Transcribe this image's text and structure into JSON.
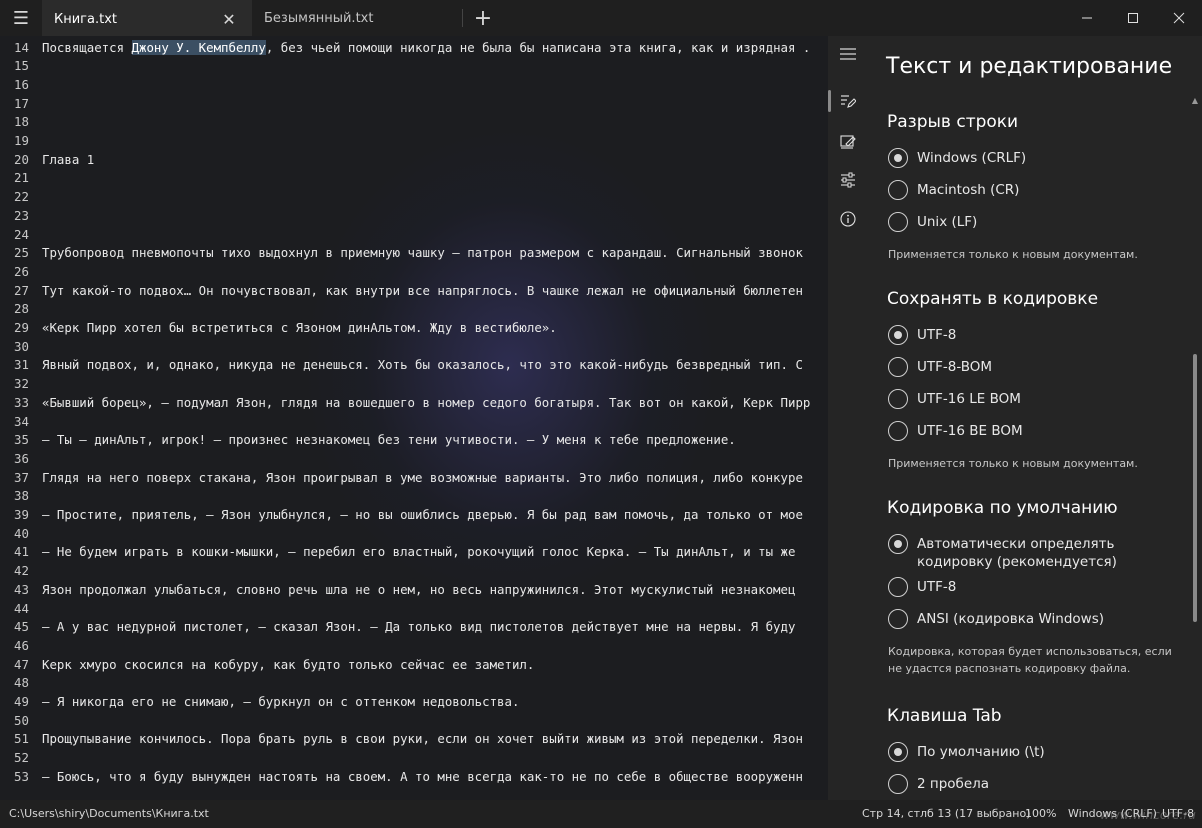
{
  "tabs": [
    {
      "label": "Книга.txt",
      "active": true
    },
    {
      "label": "Безымянный.txt",
      "active": false
    }
  ],
  "icons": {
    "menu": "hamburger-icon",
    "close": "close-icon",
    "add": "plus-icon",
    "minimize": "minimize-icon",
    "maximize": "maximize-icon"
  },
  "editor": {
    "highlight_color": "#3b4f63",
    "lines": [
      {
        "n": "14",
        "pre": "Посвящается ",
        "hl": "Джону У. Кемпбеллу",
        "post": ", без чьей помощи никогда не была бы написана эта книга, как и изрядная ."
      },
      {
        "n": "15",
        "text": ""
      },
      {
        "n": "16",
        "text": ""
      },
      {
        "n": "17",
        "text": ""
      },
      {
        "n": "18",
        "text": ""
      },
      {
        "n": "19",
        "text": ""
      },
      {
        "n": "20",
        "text": "Глава 1"
      },
      {
        "n": "21",
        "text": ""
      },
      {
        "n": "22",
        "text": ""
      },
      {
        "n": "23",
        "text": ""
      },
      {
        "n": "24",
        "text": ""
      },
      {
        "n": "25",
        "text": "Трубопровод пневмопочты тихо выдохнул в приемную чашку – патрон размером с карандаш. Сигнальный звонок"
      },
      {
        "n": "26",
        "text": ""
      },
      {
        "n": "27",
        "text": "Тут какой-то подвох… Он почувствовал, как внутри все напряглось. В чашке лежал не официальный бюллетен"
      },
      {
        "n": "28",
        "text": ""
      },
      {
        "n": "29",
        "text": "«Керк Пирр хотел бы встретиться с Язоном динАльтом. Жду в вестибюле»."
      },
      {
        "n": "30",
        "text": ""
      },
      {
        "n": "31",
        "text": "Явный подвох, и, однако, никуда не денешься. Хоть бы оказалось, что это какой-нибудь безвредный тип. С"
      },
      {
        "n": "32",
        "text": ""
      },
      {
        "n": "33",
        "text": "«Бывший борец», – подумал Язон, глядя на вошедшего в номер седого богатыря. Так вот он какой, Керк Пирр"
      },
      {
        "n": "34",
        "text": ""
      },
      {
        "n": "35",
        "text": "– Ты – динАльт, игрок! – произнес незнакомец без тени учтивости. – У меня к тебе предложение."
      },
      {
        "n": "36",
        "text": ""
      },
      {
        "n": "37",
        "text": "Глядя на него поверх стакана, Язон проигрывал в уме возможные варианты. Это либо полиция, либо конкуре"
      },
      {
        "n": "38",
        "text": ""
      },
      {
        "n": "39",
        "text": "– Простите, приятель, – Язон улыбнулся, – но вы ошиблись дверью. Я бы рад вам помочь, да только от мое"
      },
      {
        "n": "40",
        "text": ""
      },
      {
        "n": "41",
        "text": "– Не будем играть в кошки-мышки, – перебил его властный, рокочущий голос Керка. – Ты динАльт, и ты же"
      },
      {
        "n": "42",
        "text": ""
      },
      {
        "n": "43",
        "text": "Язон продолжал улыбаться, словно речь шла не о нем, но весь напружинился. Этот мускулистый незнакомец"
      },
      {
        "n": "44",
        "text": ""
      },
      {
        "n": "45",
        "text": "– А у вас недурной пистолет, – сказал Язон. – Да только вид пистолетов действует мне на нервы. Я буду"
      },
      {
        "n": "46",
        "text": ""
      },
      {
        "n": "47",
        "text": "Керк хмуро скосился на кобуру, как будто только сейчас ее заметил."
      },
      {
        "n": "48",
        "text": ""
      },
      {
        "n": "49",
        "text": "– Я никогда его не снимаю, – буркнул он с оттенком недовольства."
      },
      {
        "n": "50",
        "text": ""
      },
      {
        "n": "51",
        "text": "Прощупывание кончилось. Пора брать руль в свои руки, если он хочет выйти живым из этой переделки. Язон"
      },
      {
        "n": "52",
        "text": ""
      },
      {
        "n": "53",
        "text": "– Боюсь, что я буду вынужден настоять на своем. А то мне всегда как-то не по себе в обществе вооруженн"
      }
    ]
  },
  "nav_rail": {
    "items": [
      "hamburger-icon",
      "edit-text-icon",
      "personalize-icon",
      "sliders-icon",
      "info-icon"
    ],
    "selected_index": 1
  },
  "settings": {
    "title": "Текст и редактирование",
    "sections": [
      {
        "title": "Разрыв строки",
        "options": [
          {
            "label": "Windows (CRLF)",
            "checked": true
          },
          {
            "label": "Macintosh (CR)",
            "checked": false
          },
          {
            "label": "Unix (LF)",
            "checked": false
          }
        ],
        "hint": "Применяется только к новым документам."
      },
      {
        "title": "Сохранять в кодировке",
        "options": [
          {
            "label": "UTF-8",
            "checked": true
          },
          {
            "label": "UTF-8-BOM",
            "checked": false
          },
          {
            "label": "UTF-16 LE BOM",
            "checked": false
          },
          {
            "label": "UTF-16 BE BOM",
            "checked": false
          }
        ],
        "hint": "Применяется только к новым документам."
      },
      {
        "title": "Кодировка по умолчанию",
        "options": [
          {
            "label": "Автоматически определять кодировку (рекомендуется)",
            "checked": true
          },
          {
            "label": "UTF-8",
            "checked": false
          },
          {
            "label": "ANSI (кодировка Windows)",
            "checked": false
          }
        ],
        "hint": "Кодировка, которая будет использоваться, если не удастся распознать кодировку файла."
      },
      {
        "title": "Клавиша Tab",
        "options": [
          {
            "label": "По умолчанию (\\t)",
            "checked": true
          },
          {
            "label": "2 пробела",
            "checked": false
          }
        ],
        "hint": ""
      }
    ]
  },
  "statusbar": {
    "path": "C:\\Users\\shiry\\Documents\\Книга.txt",
    "position": "Стр 14, стлб 13 (17 выбрано)",
    "zoom": "100%",
    "line_ending": "Windows (CRLF)",
    "encoding": "UTF-8",
    "watermark": "www.wincore.ru"
  }
}
